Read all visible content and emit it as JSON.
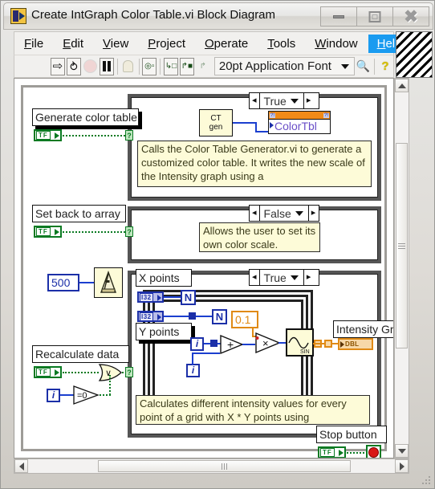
{
  "window": {
    "title": "Create IntGraph Color Table.vi Block Diagram",
    "vi_icon": "labview-vi-icon",
    "buttons": {
      "minimize": "minimize-icon",
      "maximize": "maximize-icon",
      "close": "close-icon"
    }
  },
  "menubar": {
    "items": [
      {
        "label": "File",
        "accel": "F"
      },
      {
        "label": "Edit",
        "accel": "E"
      },
      {
        "label": "View",
        "accel": "V"
      },
      {
        "label": "Project",
        "accel": "P"
      },
      {
        "label": "Operate",
        "accel": "O"
      },
      {
        "label": "Tools",
        "accel": "T"
      },
      {
        "label": "Window",
        "accel": "W"
      },
      {
        "label": "Help",
        "accel": "H"
      }
    ],
    "active_item": "Help",
    "active_color": "#1a9bf0"
  },
  "toolbar": {
    "run_label": "⇨",
    "run_continuous_label": "⥁",
    "abort_label": "abort-icon",
    "pause_label": "pause-icon",
    "highlight_label": "highlight-execution-icon",
    "step_label": "➘■",
    "step_into_label": "↳□",
    "step_over_label": "↱■",
    "step_out_label": "↱",
    "font_value": "20pt Application Font",
    "search_icon": "search-icon",
    "help_icon": "context-help-icon",
    "help_glyph": "?"
  },
  "diagram": {
    "case1": {
      "label": "Generate color table",
      "terminal": "TF",
      "selector": "True",
      "subvi": "CT\ngen",
      "subvi_line1": "CT",
      "subvi_line2": "gen",
      "property_node": "ColorTbl",
      "prop_badge_left": "?!",
      "prop_badge_right": "?!",
      "comment": "Calls the Color Table Generator.vi to generate a customized color table. It writes the new scale of the Intensity graph using a"
    },
    "case2": {
      "label": "Set back to array",
      "terminal": "TF",
      "selector": "False",
      "comment": "Allows the user to set its own color scale."
    },
    "case3": {
      "label": "Recalculate data",
      "terminal": "TF",
      "selector": "True",
      "wait_constant": "500",
      "wait_subvi": "wait-ms-metronome-icon",
      "x_points_label": "X points",
      "y_points_label": "Y points",
      "x_points_type": "I32",
      "y_points_type": "I32",
      "outer_loop_count": "N",
      "inner_loop_count": "N",
      "outer_index": "i",
      "inner_index": "i",
      "multiply_constant": "0.1",
      "add_glyph": "+",
      "multiply_glyph": "×",
      "sin_label": "SIN",
      "compare_glyph": "=0",
      "or_glyph": "∨",
      "iteration_terminal": "i",
      "indicator_label": "Intensity Grap",
      "indicator_type": "DBL",
      "comment": "Calculates different intensity values for every point of a grid with X * Y points using"
    },
    "stop": {
      "label": "Stop button",
      "terminal": "TF",
      "led": "stop-led-icon"
    }
  },
  "scrollbars": {
    "vertical": {
      "up": "scroll-up-arrow",
      "down": "scroll-down-arrow",
      "thumb": "v-scroll-thumb"
    },
    "horizontal": {
      "left": "scroll-left-arrow",
      "right": "scroll-right-arrow",
      "thumb": "h-scroll-thumb"
    },
    "resizer": "window-resize-grip"
  }
}
